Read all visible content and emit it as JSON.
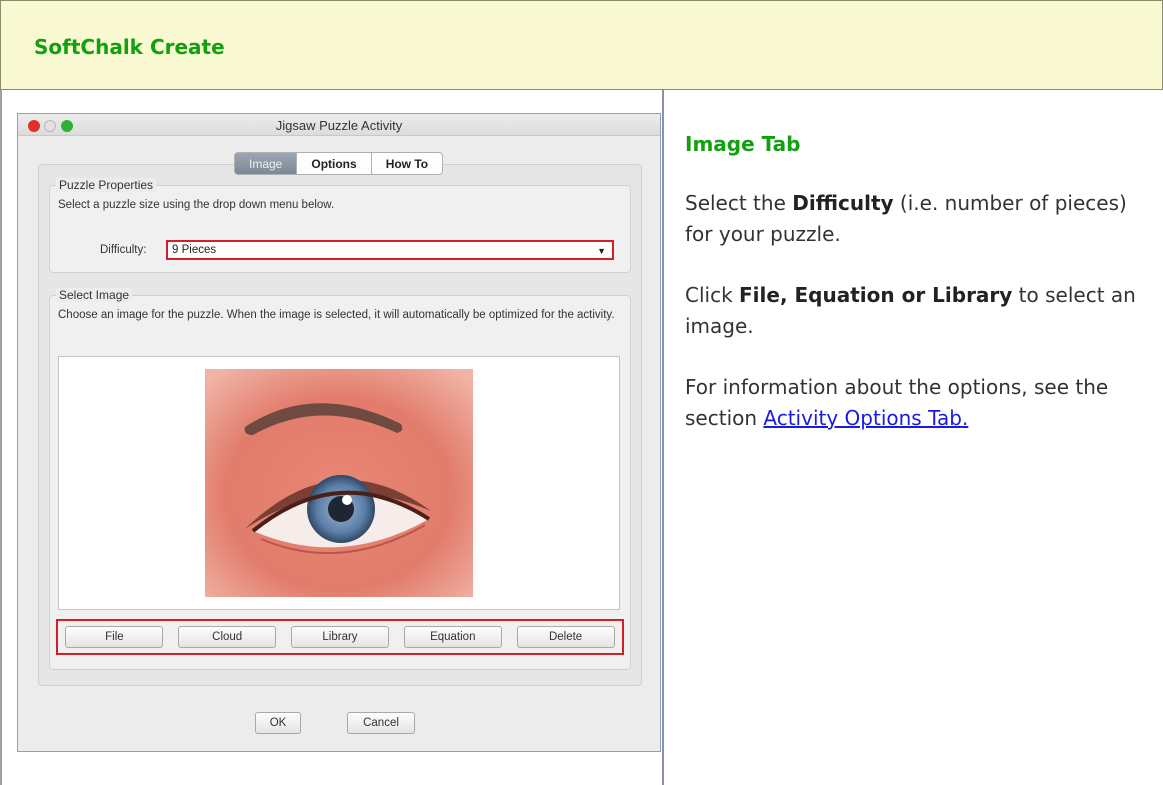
{
  "header": {
    "title": "SoftChalk Create"
  },
  "dialog": {
    "title": "Jigsaw Puzzle Activity",
    "tabs": [
      {
        "label": "Image",
        "active": true
      },
      {
        "label": "Options",
        "active": false
      },
      {
        "label": "How To",
        "active": false
      }
    ],
    "puzzle_properties": {
      "label": "Puzzle Properties",
      "instruction": "Select a puzzle size using the drop down menu below.",
      "difficulty_label": "Difficulty:",
      "difficulty_value": "9 Pieces"
    },
    "select_image": {
      "label": "Select Image",
      "instruction": "Choose an image for the puzzle. When the image is selected, it will automatically be optimized for the activity."
    },
    "buttons": [
      "File",
      "Cloud",
      "Library",
      "Equation",
      "Delete"
    ],
    "ok_label": "OK",
    "cancel_label": "Cancel"
  },
  "right_panel": {
    "heading": "Image Tab",
    "p1_pre": "Select the ",
    "p1_bold": "Difficulty",
    "p1_post": " (i.e. number of pieces) for your puzzle.",
    "p2_pre": "Click ",
    "p2_bold": "File, Equation or Library",
    "p2_post": " to select an image.",
    "p3_pre": "For information about the options, see the section ",
    "p3_link": "Activity Options Tab",
    "p3_post": "."
  },
  "colors": {
    "header_bg": "#fafad2",
    "title_green": "#11a010",
    "highlight_red": "#d21f2c",
    "link_blue": "#1a1ae6"
  }
}
